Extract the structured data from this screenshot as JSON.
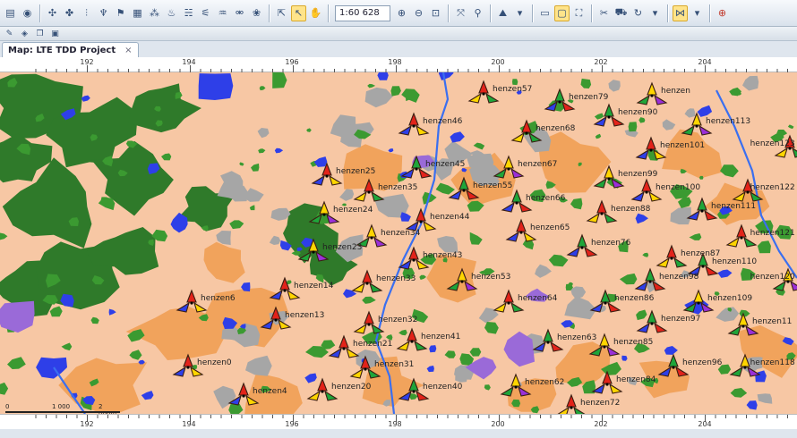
{
  "toolbar": {
    "scale_value": "1:60 628",
    "icons": [
      "layers-icon",
      "zoom-extent-icon",
      "site-icon",
      "cell-icon",
      "transmitter-icon",
      "repeater-icon",
      "antenna-icon",
      "microwave-icon",
      "traffic-icon",
      "prediction-icon",
      "coverage-icon",
      "neighbour-icon",
      "frequency-icon",
      "pointer-icon",
      "select-icon",
      "pan-icon",
      "zoom-in-icon",
      "zoom-out-icon",
      "zoom-area-icon",
      "measure-icon",
      "find-icon",
      "terrain-icon",
      "legend-icon",
      "binoculars-icon",
      "route-icon",
      "drive-test-icon",
      "refresh-icon",
      "settings-icon"
    ]
  },
  "tab": {
    "title": "Map: LTE TDD Project",
    "close": "×"
  },
  "ruler": {
    "labels": [
      "192",
      "194",
      "196",
      "198",
      "200",
      "202",
      "204"
    ]
  },
  "scalebar": {
    "left": "0",
    "mid": "1 000",
    "right": "2 000m"
  },
  "colors": {
    "base": "#f7c7a4",
    "urban": "#f1a35c",
    "forest": "#2f7a2a",
    "grass": "#3b9a31",
    "water": "#2e3fe8",
    "builtup": "#a6a6a6",
    "industrial": "#9a6ad8"
  },
  "sites": [
    {
      "label": "henzen57"
    },
    {
      "label": "henzen79"
    },
    {
      "label": "henzen"
    },
    {
      "label": "henzen46"
    },
    {
      "label": "henzen68"
    },
    {
      "label": "henzen90"
    },
    {
      "label": "henzen113"
    },
    {
      "label": "henzen101"
    },
    {
      "label": "henzen123"
    },
    {
      "label": "henzen45"
    },
    {
      "label": "henzen67"
    },
    {
      "label": "henzen25"
    },
    {
      "label": "henzen35"
    },
    {
      "label": "henzen55"
    },
    {
      "label": "henzen99"
    },
    {
      "label": "henzen100"
    },
    {
      "label": "henzen122"
    },
    {
      "label": "henzen66"
    },
    {
      "label": "henzen24"
    },
    {
      "label": "henzen44"
    },
    {
      "label": "henzen88"
    },
    {
      "label": "henzen111"
    },
    {
      "label": "henzen34"
    },
    {
      "label": "henzen65"
    },
    {
      "label": "henzen121"
    },
    {
      "label": "henzen76"
    },
    {
      "label": "henzen23"
    },
    {
      "label": "henzen43"
    },
    {
      "label": "henzen87"
    },
    {
      "label": "henzen110"
    },
    {
      "label": "henzen53"
    },
    {
      "label": "henzen14"
    },
    {
      "label": "henzen33"
    },
    {
      "label": "henzen98"
    },
    {
      "label": "henzen120"
    },
    {
      "label": "henzen6"
    },
    {
      "label": "henzen64"
    },
    {
      "label": "henzen86"
    },
    {
      "label": "henzen109"
    },
    {
      "label": "henzen13"
    },
    {
      "label": "henzen32"
    },
    {
      "label": "henzen97"
    },
    {
      "label": "henzen11"
    },
    {
      "label": "henzen21"
    },
    {
      "label": "henzen41"
    },
    {
      "label": "henzen63"
    },
    {
      "label": "henzen85"
    },
    {
      "label": "henzen0"
    },
    {
      "label": "henzen31"
    },
    {
      "label": "henzen96"
    },
    {
      "label": "henzen118"
    },
    {
      "label": "henzen4"
    },
    {
      "label": "henzen20"
    },
    {
      "label": "henzen40"
    },
    {
      "label": "henzen62"
    },
    {
      "label": "henzen84"
    },
    {
      "label": "henzen72"
    }
  ]
}
